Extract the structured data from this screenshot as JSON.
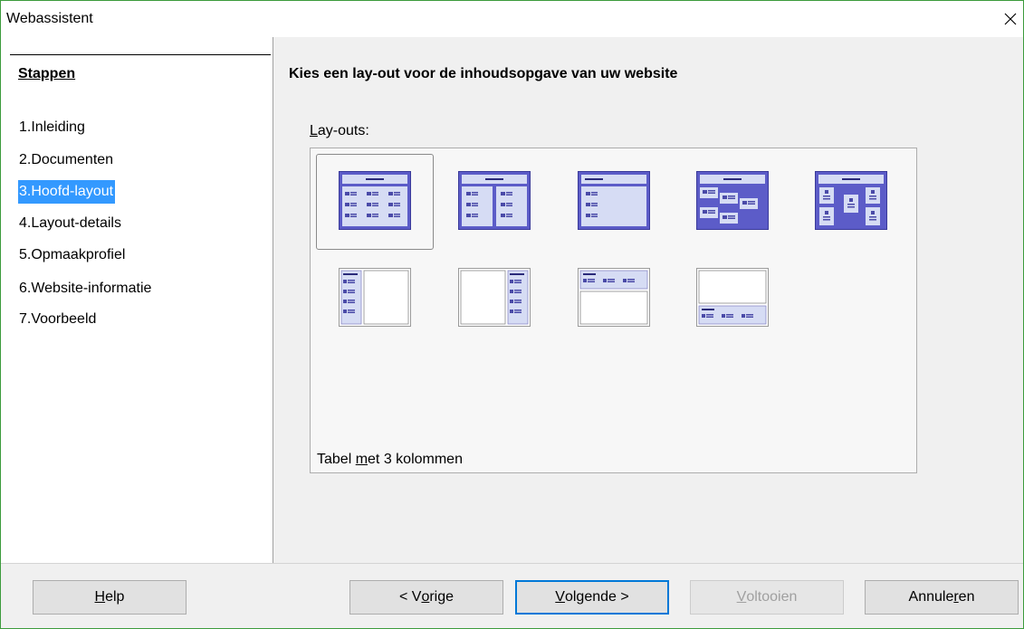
{
  "window": {
    "title": "Webassistent"
  },
  "sidebar": {
    "heading": "Stappen",
    "steps": [
      {
        "num": "1.",
        "label": "Inleiding"
      },
      {
        "num": "2.",
        "label": "Documenten"
      },
      {
        "num": "3.",
        "label": "Hoofd-layout",
        "active": true
      },
      {
        "num": "4.",
        "label": "Layout-details"
      },
      {
        "num": "5.",
        "label": "Opmaakprofiel"
      },
      {
        "num": "6.",
        "label": "Website-informatie"
      },
      {
        "num": "7.",
        "label": "Voorbeeld"
      }
    ]
  },
  "main": {
    "heading": "Kies een lay-out voor de inhoudsopgave van uw website",
    "layouts_label": {
      "pre": "",
      "key": "L",
      "post": "ay-outs:"
    },
    "description": {
      "pre": "Tabel ",
      "key": "m",
      "post": "et 3 kolommen"
    }
  },
  "buttons": {
    "help": {
      "pre": "",
      "key": "H",
      "post": "elp"
    },
    "back": {
      "pre": "< V",
      "key": "o",
      "post": "rige"
    },
    "next": {
      "pre": "",
      "key": "V",
      "post": "olgende >"
    },
    "finish": {
      "pre": "",
      "key": "V",
      "post": "oltooien"
    },
    "cancel": {
      "pre": "Annule",
      "key": "r",
      "post": "en"
    }
  },
  "colors": {
    "accent": "#3399ff",
    "layout_blue": "#5c5cc8",
    "layout_light": "#d6dcf4",
    "window_border": "#3c9b3c"
  }
}
